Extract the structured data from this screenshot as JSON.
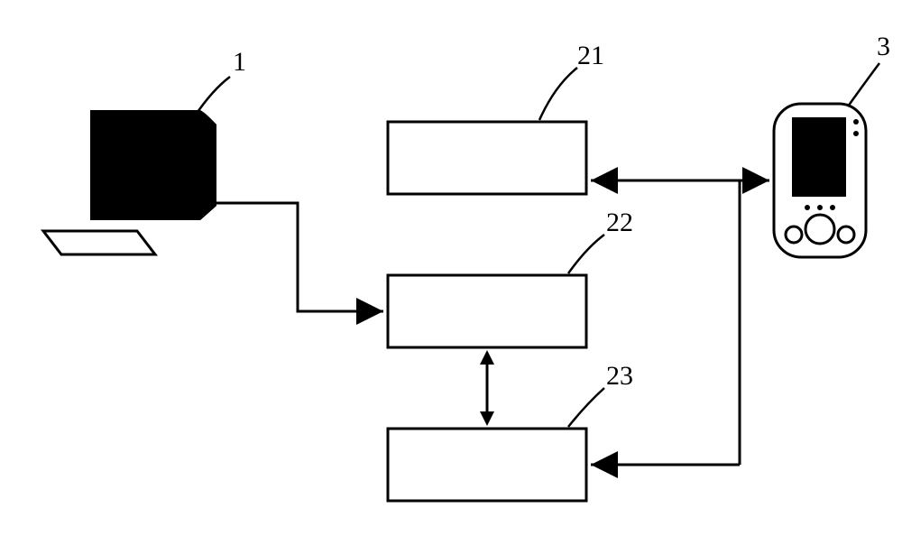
{
  "labels": {
    "computer": "1",
    "mobile": "3",
    "box_top": "21",
    "box_middle": "22",
    "box_bottom": "23"
  }
}
